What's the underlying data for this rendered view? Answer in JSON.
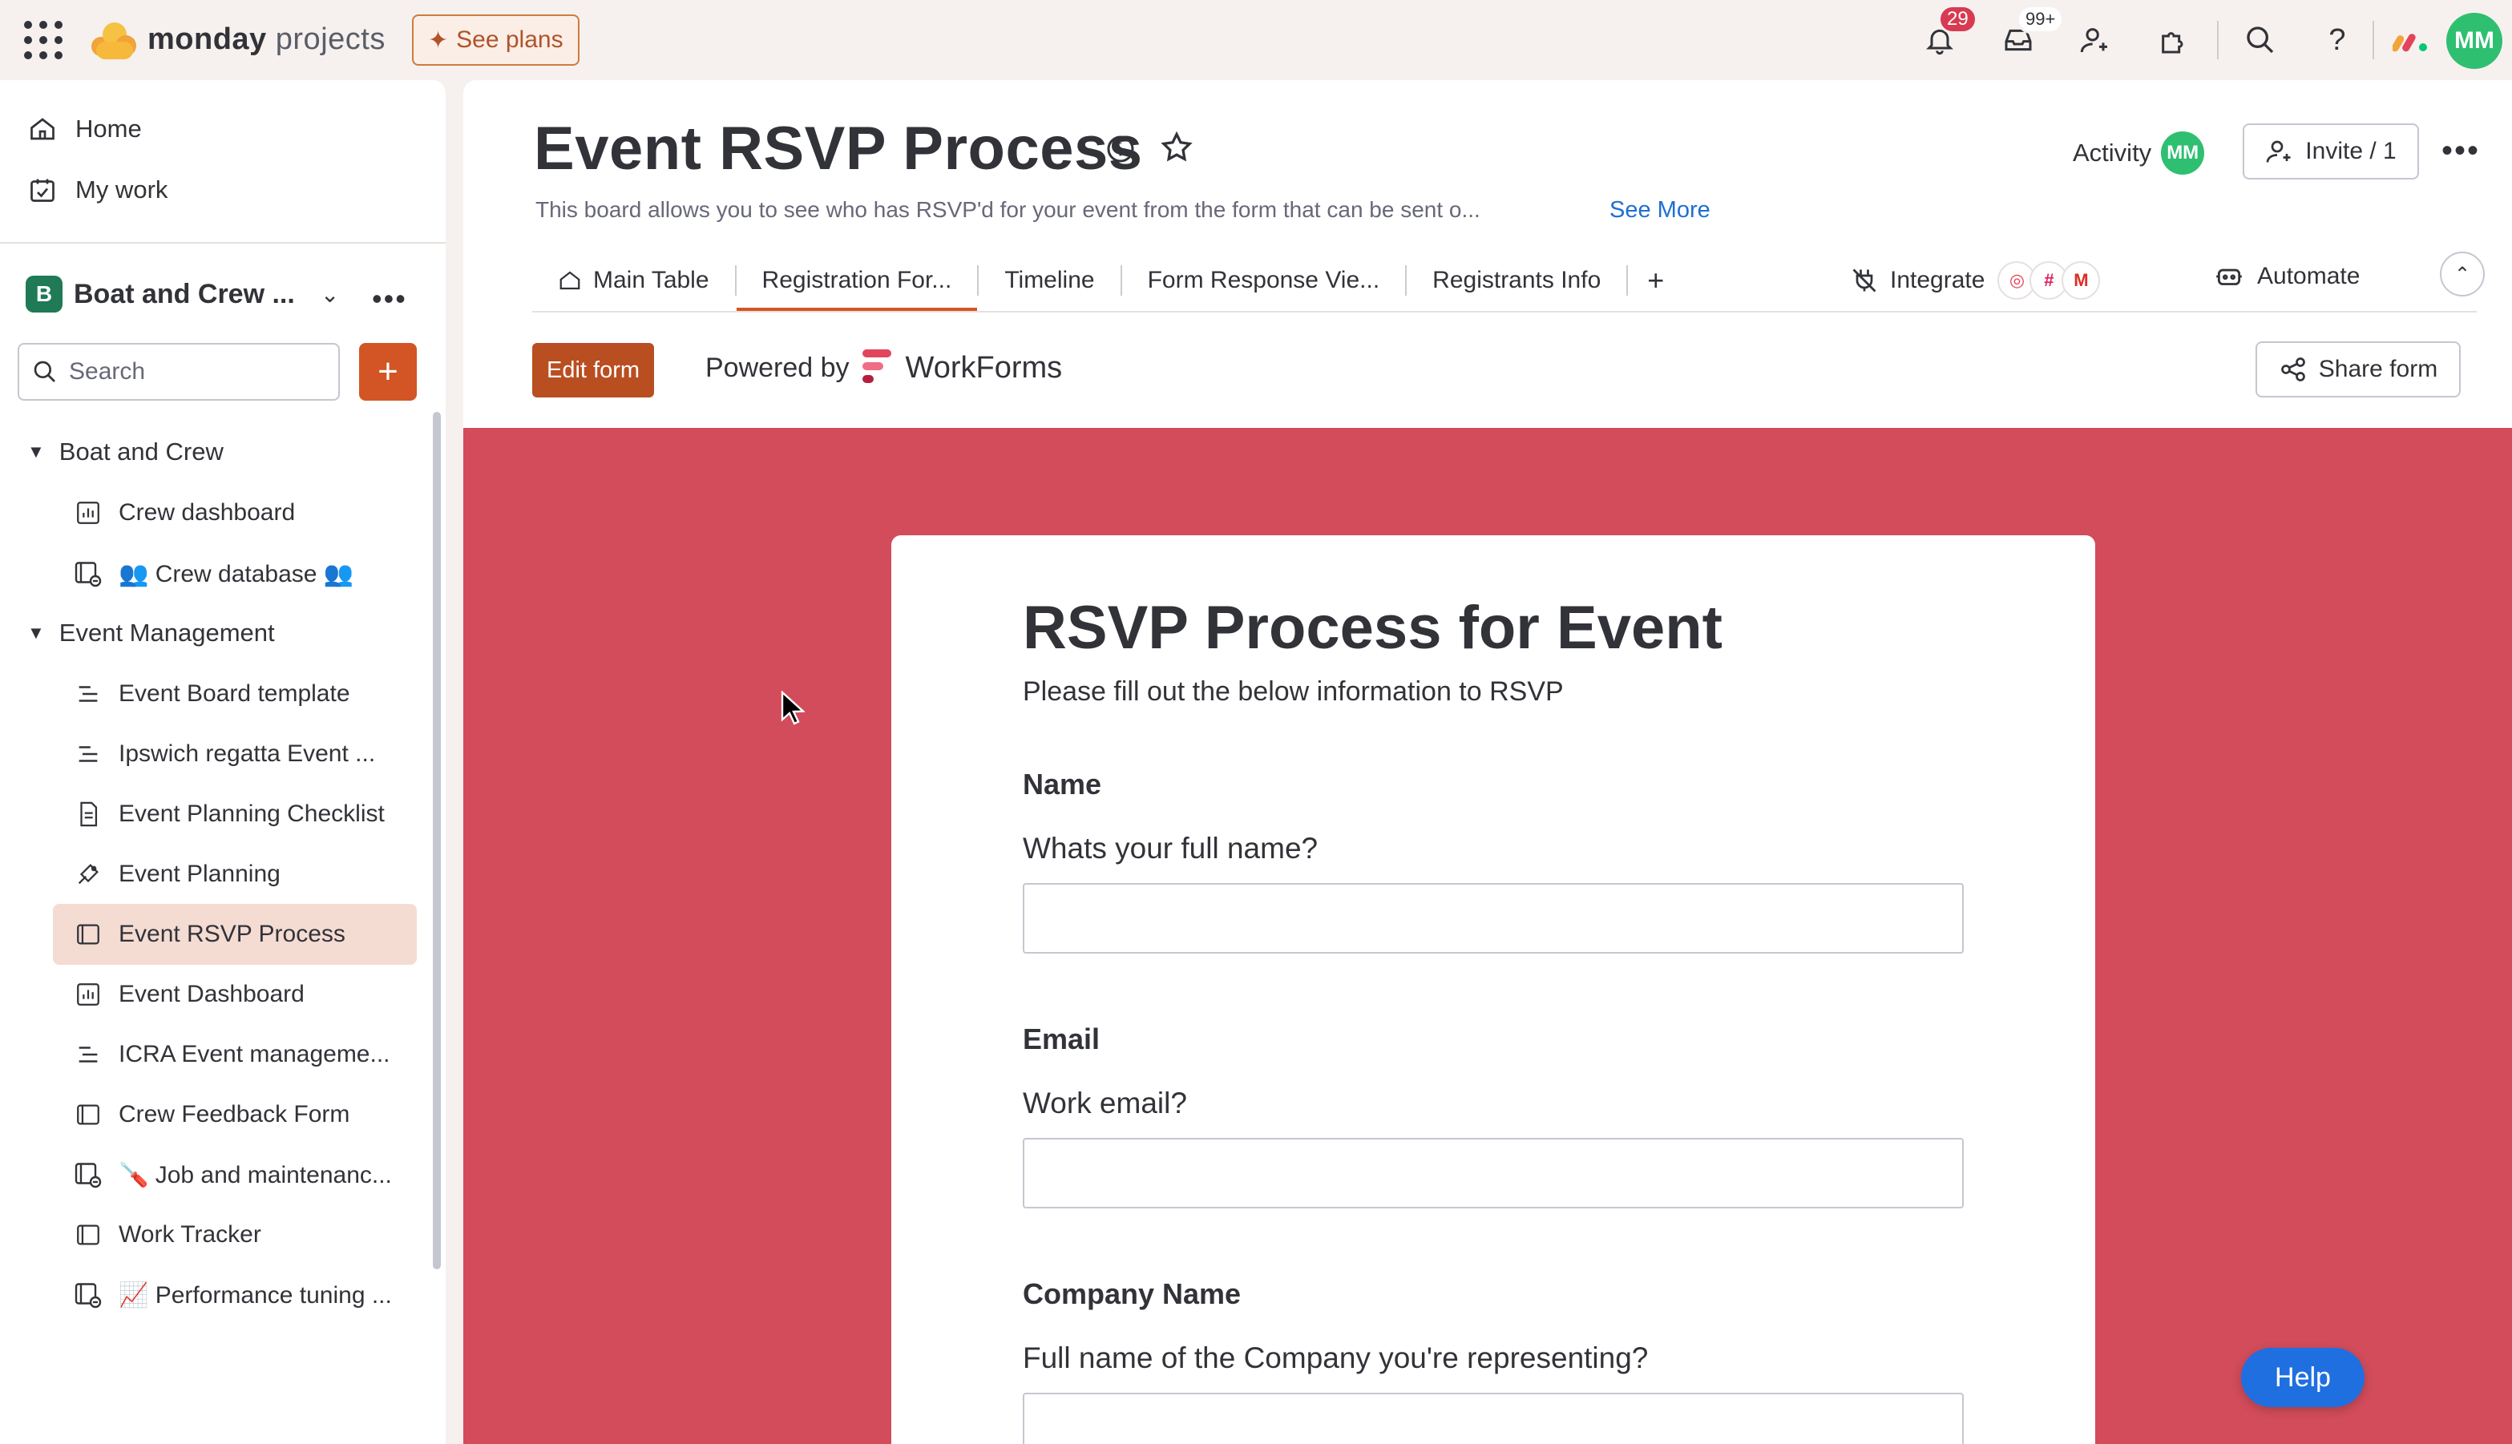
{
  "topbar": {
    "brand_bold": "monday",
    "brand_light": "projects",
    "see_plans": "See plans",
    "notifications_count": "29",
    "inbox_count": "99+",
    "user_initials": "MM",
    "icons": [
      "apps-grid-icon",
      "bell-icon",
      "inbox-icon",
      "invite-user-icon",
      "apps-icon",
      "search-icon",
      "help-icon",
      "monday-logo-icon"
    ]
  },
  "sidebar": {
    "home": "Home",
    "my_work": "My work",
    "workspace_initial": "B",
    "workspace_name": "Boat and Crew ...",
    "search_placeholder": "Search",
    "add_label": "+",
    "folders": [
      {
        "name": "Boat and Crew",
        "items": [
          {
            "label": "Crew dashboard",
            "icon": "dashboard-icon"
          },
          {
            "label": "👥 Crew database 👥",
            "icon": "connected-board-icon"
          }
        ]
      },
      {
        "name": "Event Management",
        "items": [
          {
            "label": "Event Board template",
            "icon": "board-list-icon"
          },
          {
            "label": "Ipswich regatta Event ...",
            "icon": "board-list-icon"
          },
          {
            "label": "Event Planning Checklist",
            "icon": "doc-icon"
          },
          {
            "label": "Event Planning",
            "icon": "project-icon"
          },
          {
            "label": "Event RSVP Process",
            "icon": "board-icon",
            "active": true
          },
          {
            "label": "Event Dashboard",
            "icon": "dashboard-icon"
          },
          {
            "label": "ICRA Event manageme...",
            "icon": "board-list-icon"
          },
          {
            "label": "Crew Feedback Form",
            "icon": "board-icon"
          },
          {
            "label": "🪛 Job and maintenanc...",
            "icon": "connected-board-icon"
          },
          {
            "label": "Work Tracker",
            "icon": "board-icon"
          },
          {
            "label": "📈 Performance tuning ...",
            "icon": "connected-board-icon"
          }
        ]
      }
    ]
  },
  "board": {
    "title": "Event RSVP Process",
    "description": "This board allows you to see who has RSVP'd for your event from the form that can be sent o...",
    "see_more": "See More",
    "activity": "Activity",
    "activity_initials": "MM",
    "invite": "Invite / 1",
    "tabs": [
      {
        "label": "Main Table",
        "icon": "home-icon"
      },
      {
        "label": "Registration For...",
        "active": true
      },
      {
        "label": "Timeline"
      },
      {
        "label": "Form Response Vie..."
      },
      {
        "label": "Registrants Info"
      }
    ],
    "add_tab": "+",
    "integrate": "Integrate",
    "automate": "Automate",
    "edit_form": "Edit form",
    "powered_by": "Powered by",
    "workforms": "WorkForms",
    "share_form": "Share form"
  },
  "form": {
    "background_color": "#d24c5b",
    "title": "RSVP Process for Event",
    "subtitle": "Please fill out the below information to RSVP",
    "questions": [
      {
        "label": "Name",
        "text": "Whats your full name?",
        "value": ""
      },
      {
        "label": "Email",
        "text": "Work email?",
        "value": ""
      },
      {
        "label": "Company Name",
        "text": "Full name of the Company you're representing?",
        "value": ""
      }
    ]
  },
  "help": "Help",
  "colors": {
    "accent": "#d35525",
    "link": "#1f6fd0",
    "notification_badge": "#d83a52",
    "avatar": "#2fbf71"
  }
}
